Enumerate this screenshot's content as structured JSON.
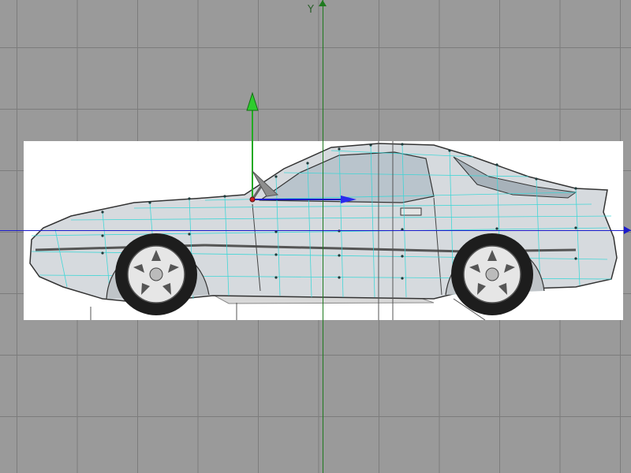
{
  "viewport": {
    "axis_label_y": "Y",
    "grid_visible": true
  },
  "colors": {
    "background": "#9a9a9a",
    "grid_line": "#7c7c7c",
    "y_axis": "#1f7a1f",
    "x_axis": "#1a1acc",
    "wireframe": "#33d6d6",
    "vertex": "#1e3a3a",
    "blueprint_bg": "#ffffff",
    "car_body": "#cfd3d6",
    "tire": "#1d1d1d"
  },
  "icons": {
    "move_gizmo_y": "up-arrow-icon",
    "move_gizmo_x": "right-arrow-icon",
    "move_gizmo_z": "diagonal-arrow-icon"
  }
}
